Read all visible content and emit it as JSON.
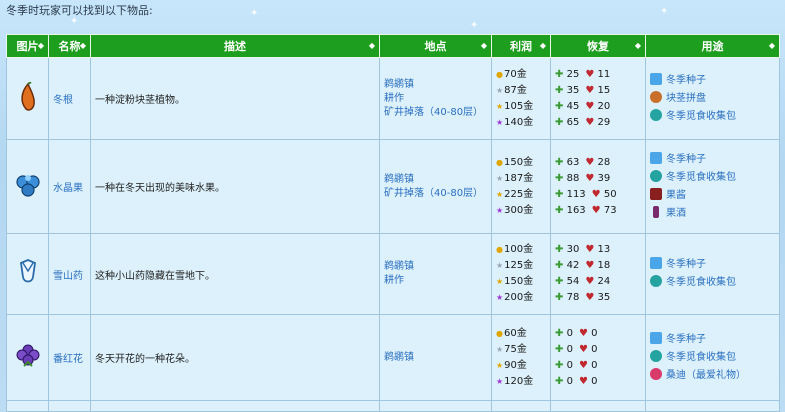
{
  "intro": "冬季时玩家可以找到以下物品:",
  "headers": [
    "图片",
    "名称",
    "描述",
    "地点",
    "利润",
    "恢复",
    "用途"
  ],
  "colors": {
    "header": "#1e9e1e",
    "cell": "#dcf1fb",
    "link": "#2b6fc0"
  },
  "rows": [
    {
      "name": "冬根",
      "icon": "winter-root-icon",
      "desc": "一种淀粉块茎植物。",
      "locations": [
        "鹈鹕镇",
        "耕作",
        "矿井掉落（40-80层）"
      ],
      "prices": [
        "70金",
        "87金",
        "105金",
        "140金"
      ],
      "energy": [
        "25",
        "35",
        "45",
        "65"
      ],
      "health": [
        "11",
        "15",
        "20",
        "29"
      ],
      "uses": [
        {
          "label": "冬季种子",
          "icon": "seed-icon"
        },
        {
          "label": "块茎拼盘",
          "icon": "dish-icon"
        },
        {
          "label": "冬季觅食收集包",
          "icon": "bundle-icon"
        }
      ]
    },
    {
      "name": "水晶果",
      "icon": "crystal-fruit-icon",
      "desc": "一种在冬天出现的美味水果。",
      "locations": [
        "鹈鹕镇",
        "矿井掉落（40-80层）"
      ],
      "prices": [
        "150金",
        "187金",
        "225金",
        "300金"
      ],
      "energy": [
        "63",
        "88",
        "113",
        "163"
      ],
      "health": [
        "28",
        "39",
        "50",
        "73"
      ],
      "uses": [
        {
          "label": "冬季种子",
          "icon": "seed-icon"
        },
        {
          "label": "冬季觅食收集包",
          "icon": "bundle-icon"
        },
        {
          "label": "果酱",
          "icon": "jelly-icon"
        },
        {
          "label": "果酒",
          "icon": "wine-icon"
        }
      ]
    },
    {
      "name": "雪山药",
      "icon": "snow-yam-icon",
      "desc": "这种小山药隐藏在雪地下。",
      "locations": [
        "鹈鹕镇",
        "耕作"
      ],
      "prices": [
        "100金",
        "125金",
        "150金",
        "200金"
      ],
      "energy": [
        "30",
        "42",
        "54",
        "78"
      ],
      "health": [
        "13",
        "18",
        "24",
        "35"
      ],
      "uses": [
        {
          "label": "冬季种子",
          "icon": "seed-icon"
        },
        {
          "label": "冬季觅食收集包",
          "icon": "bundle-icon"
        }
      ]
    },
    {
      "name": "番红花",
      "icon": "crocus-icon",
      "desc": "冬天开花的一种花朵。",
      "locations": [
        "鹈鹕镇"
      ],
      "prices": [
        "60金",
        "75金",
        "90金",
        "120金"
      ],
      "energy": [
        "0",
        "0",
        "0",
        "0"
      ],
      "health": [
        "0",
        "0",
        "0",
        "0"
      ],
      "uses": [
        {
          "label": "冬季种子",
          "icon": "seed-icon"
        },
        {
          "label": "冬季觅食收集包",
          "icon": "bundle-icon"
        },
        {
          "label": "桑迪（最爱礼物）",
          "icon": "sandy-icon"
        }
      ]
    }
  ]
}
